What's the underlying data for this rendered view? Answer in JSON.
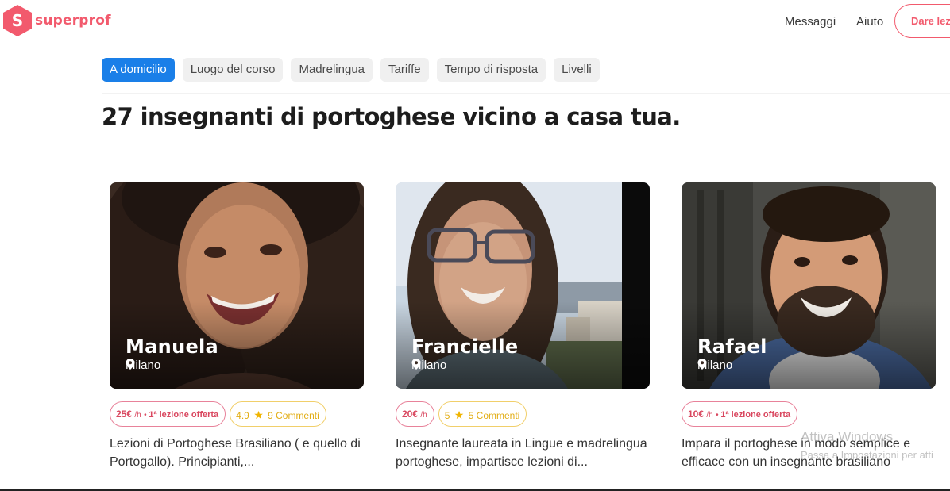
{
  "brand": {
    "logo_letter": "S",
    "name": "superprof",
    "color": "#f25a6d"
  },
  "nav": {
    "messages": "Messaggi",
    "help": "Aiuto",
    "give_lessons": "Dare lez"
  },
  "filters": [
    {
      "label": "A domicilio",
      "active": true
    },
    {
      "label": "Luogo del corso",
      "active": false
    },
    {
      "label": "Madrelingua",
      "active": false
    },
    {
      "label": "Tariffe",
      "active": false
    },
    {
      "label": "Tempo di risposta",
      "active": false
    },
    {
      "label": "Livelli",
      "active": false
    }
  ],
  "headline": "27 insegnanti di portoghese vicino a casa tua.",
  "tutors": [
    {
      "name": "Manuela",
      "location": "Milano",
      "price": "25€",
      "unit": "/h",
      "offer": "1ª lezione offerta",
      "rating": "4.9",
      "reviews": "9 Commenti",
      "description": "Lezioni di Portoghese Brasiliano ( e quello di Portogallo). Principianti,..."
    },
    {
      "name": "Francielle",
      "location": "Milano",
      "price": "20€",
      "unit": "/h",
      "offer": "",
      "rating": "5",
      "reviews": "5 Commenti",
      "description": "Insegnante laureata in Lingue e madrelingua portoghese, impartisce lezioni di..."
    },
    {
      "name": "Rafael",
      "location": "Milano",
      "price": "10€",
      "unit": "/h",
      "offer": "1ª lezione offerta",
      "rating": "",
      "reviews": "",
      "description": "Impara il portoghese in modo semplice e efficace con un insegnante brasiliano"
    }
  ],
  "windows_watermark": {
    "title": "Attiva Windows",
    "subtitle": "Passa a Impostazioni per atti"
  }
}
